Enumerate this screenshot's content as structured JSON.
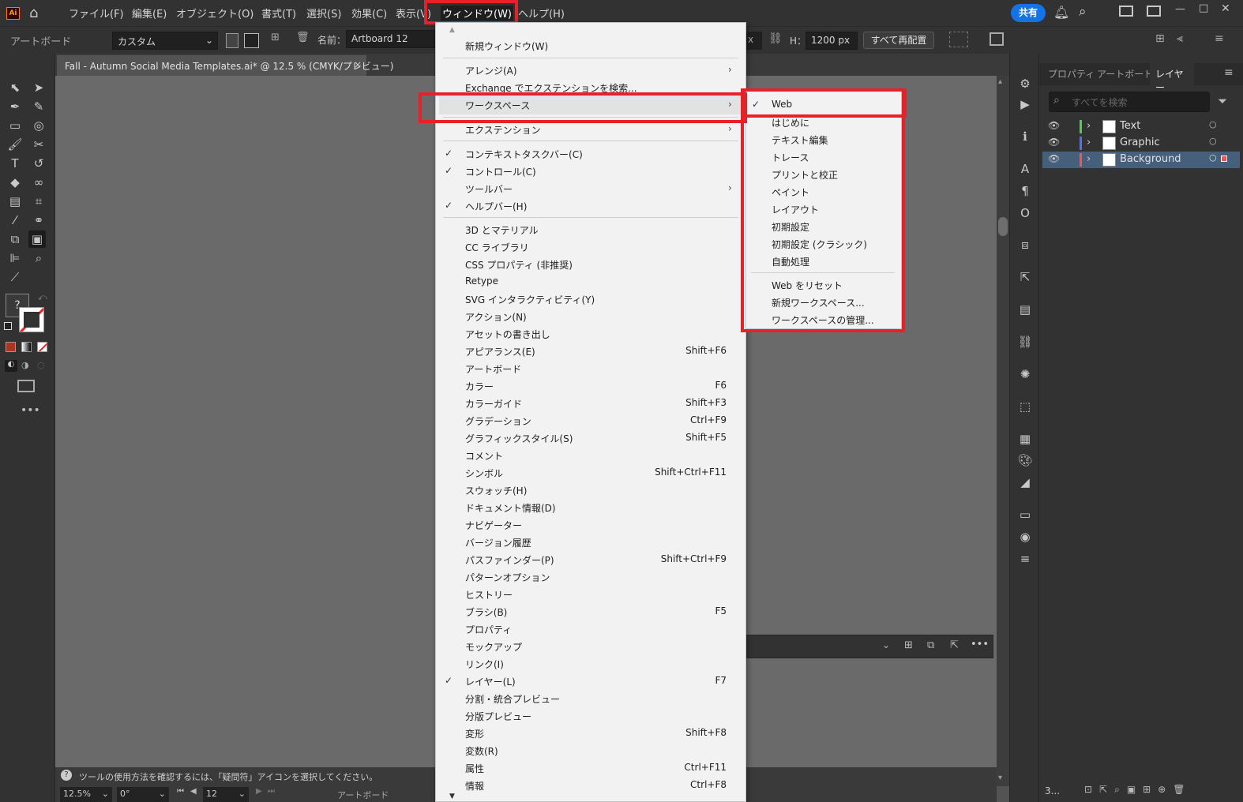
{
  "app": {
    "logo": "Ai",
    "icons": [
      "home-icon",
      "notifications-icon",
      "search-icon",
      "arrange-documents-icon",
      "workspace-icon"
    ],
    "share": "共有"
  },
  "menubar": {
    "items": [
      "ファイル(F)",
      "編集(E)",
      "オブジェクト(O)",
      "書式(T)",
      "選択(S)",
      "効果(C)",
      "表示(V)",
      "ウィンドウ(W)",
      "ヘルプ(H)"
    ]
  },
  "control": {
    "panel_label": "アートボード",
    "preset": "カスタム",
    "name_label": "名前：",
    "artboard_name": "Artboard 12",
    "h_label": "H：",
    "h_value": "1200 px",
    "rearrange": "すべて再配置"
  },
  "document": {
    "tab": "Fall - Autumn Social Media Templates.ai* @ 12.5 % (CMYK/プレビュー)"
  },
  "status": {
    "hint": "ツールの使用方法を確認するには、「疑問符」アイコンを選択してください。",
    "zoom": "12.5%",
    "rotate": "0°",
    "artboard_no": "12",
    "artboard_label": "アートボード"
  },
  "window_menu": {
    "items": [
      {
        "label": "新規ウィンドウ(W)"
      },
      {
        "label": "アレンジ(A)"
      },
      {
        "label": "Exchange でエクステンションを検索..."
      },
      {
        "label": "ワークスペース"
      },
      {
        "label": "エクステンション"
      },
      {
        "label": "コンテキストタスクバー(C)",
        "checked": true
      },
      {
        "label": "コントロール(C)",
        "checked": true
      },
      {
        "label": "ツールバー"
      },
      {
        "label": "ヘルプバー(H)",
        "checked": true
      },
      {
        "label": "3D とマテリアル"
      },
      {
        "label": "CC ライブラリ"
      },
      {
        "label": "CSS プロパティ (非推奨)"
      },
      {
        "label": "Retype"
      },
      {
        "label": "SVG インタラクティビティ(Y)"
      },
      {
        "label": "アクション(N)"
      },
      {
        "label": "アセットの書き出し"
      },
      {
        "label": "アピアランス(E)",
        "shortcut": "Shift+F6"
      },
      {
        "label": "アートボード"
      },
      {
        "label": "カラー",
        "shortcut": "F6"
      },
      {
        "label": "カラーガイド",
        "shortcut": "Shift+F3"
      },
      {
        "label": "グラデーション",
        "shortcut": "Ctrl+F9"
      },
      {
        "label": "グラフィックスタイル(S)",
        "shortcut": "Shift+F5"
      },
      {
        "label": "コメント"
      },
      {
        "label": "シンボル",
        "shortcut": "Shift+Ctrl+F11"
      },
      {
        "label": "スウォッチ(H)"
      },
      {
        "label": "ドキュメント情報(D)"
      },
      {
        "label": "ナビゲーター"
      },
      {
        "label": "バージョン履歴"
      },
      {
        "label": "パスファインダー(P)",
        "shortcut": "Shift+Ctrl+F9"
      },
      {
        "label": "パターンオプション"
      },
      {
        "label": "ヒストリー"
      },
      {
        "label": "ブラシ(B)",
        "shortcut": "F5"
      },
      {
        "label": "プロパティ"
      },
      {
        "label": "モックアップ"
      },
      {
        "label": "リンク(I)"
      },
      {
        "label": "レイヤー(L)",
        "shortcut": "F7",
        "checked": true
      },
      {
        "label": "分割・統合プレビュー"
      },
      {
        "label": "分版プレビュー"
      },
      {
        "label": "変形",
        "shortcut": "Shift+F8"
      },
      {
        "label": "変数(R)"
      },
      {
        "label": "属性",
        "shortcut": "Ctrl+F11"
      },
      {
        "label": "情報",
        "shortcut": "Ctrl+F8"
      }
    ]
  },
  "workspace_submenu": {
    "items": [
      {
        "label": "Web",
        "checked": true
      },
      {
        "label": "はじめに"
      },
      {
        "label": "テキスト編集"
      },
      {
        "label": "トレース"
      },
      {
        "label": "プリントと校正"
      },
      {
        "label": "ペイント"
      },
      {
        "label": "レイアウト"
      },
      {
        "label": "初期設定"
      },
      {
        "label": "初期設定 (クラシック)"
      },
      {
        "label": "自動処理"
      },
      {
        "label": "Web をリセット"
      },
      {
        "label": "新規ワークスペース..."
      },
      {
        "label": "ワークスペースの管理..."
      }
    ]
  },
  "layers_panel": {
    "tabs": [
      "プロパティ",
      "アートボード",
      "レイヤー"
    ],
    "search_placeholder": "すべてを検索",
    "layers": [
      {
        "name": "Text",
        "color": "#4fcf4f"
      },
      {
        "name": "Graphic",
        "color": "#4f6fff"
      },
      {
        "name": "Background",
        "color": "#ff4f4f",
        "selected": true
      }
    ],
    "count": "3..."
  },
  "colors": {
    "highlight": "#e8202a",
    "accent": "#1473e6",
    "selected_layer": "#46607c"
  }
}
